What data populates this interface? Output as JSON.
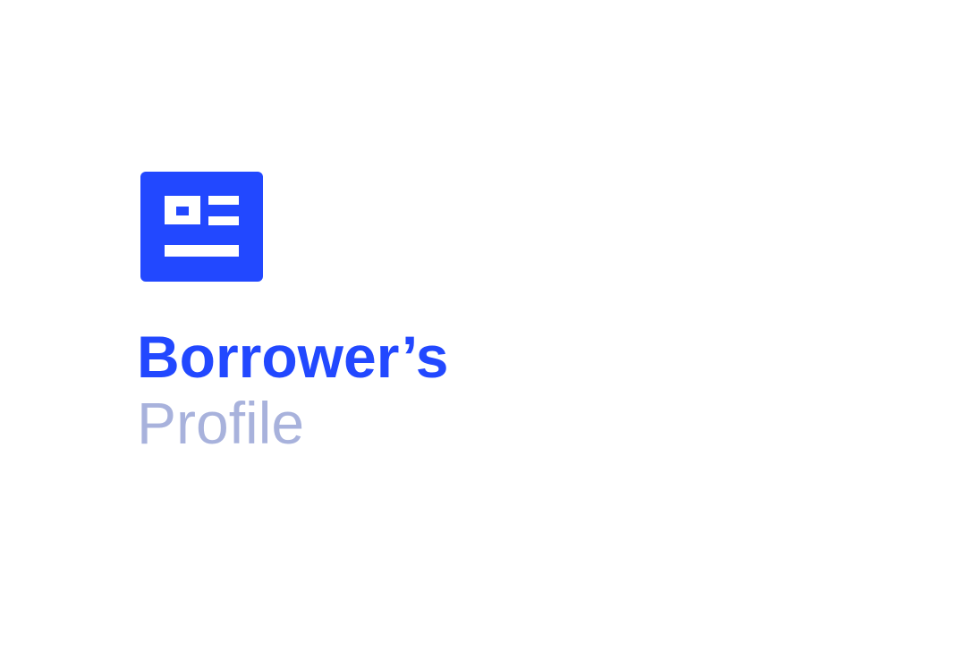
{
  "brand": {
    "icon": "profile-card-icon",
    "accent_color": "#2248ff",
    "secondary_color": "#a8b2dc"
  },
  "title": {
    "line1": "Borrower’s",
    "line2": "Profile"
  }
}
